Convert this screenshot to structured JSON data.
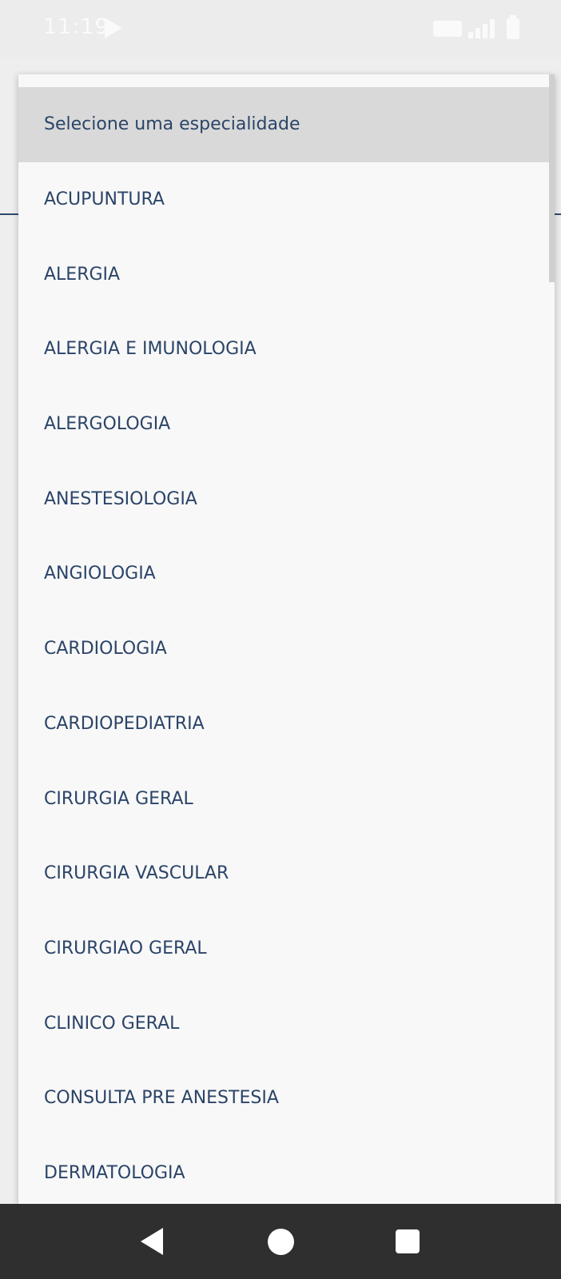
{
  "status_bar": {
    "time": "11:19",
    "icons": [
      "play-store-icon",
      "volte-icon",
      "signal-icon",
      "battery-icon"
    ]
  },
  "dropdown": {
    "selected_index": 0,
    "options": [
      "Selecione uma especialidade",
      "ACUPUNTURA",
      "ALERGIA",
      "ALERGIA E IMUNOLOGIA",
      "ALERGOLOGIA",
      "ANESTESIOLOGIA",
      "ANGIOLOGIA",
      "CARDIOLOGIA",
      "CARDIOPEDIATRIA",
      "CIRURGIA GERAL",
      "CIRURGIA VASCULAR",
      "CIRURGIAO GERAL",
      "CLINICO GERAL",
      "CONSULTA PRE ANESTESIA",
      "DERMATOLOGIA"
    ]
  },
  "nav_bar": {
    "icons": [
      "back-icon",
      "home-icon",
      "recents-icon"
    ]
  },
  "colors": {
    "option_text": "#2b4468",
    "selected_bg": "#d9d9d9",
    "dropdown_bg": "#f8f8f8",
    "nav_bg": "#2f2f2f"
  }
}
